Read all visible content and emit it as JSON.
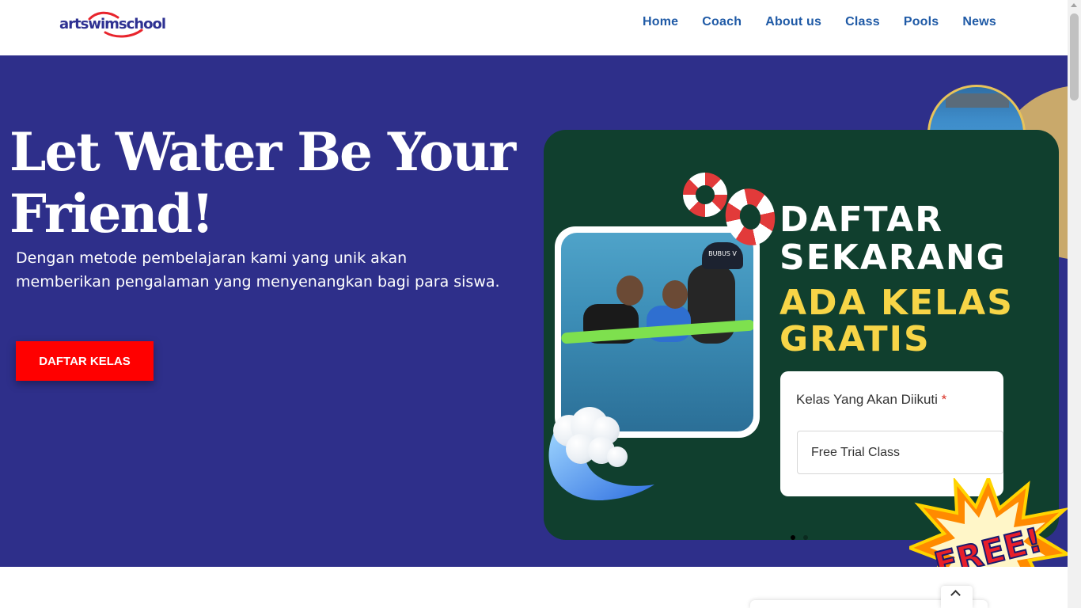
{
  "header": {
    "logo_text": "artswimschool",
    "nav": [
      "Home",
      "Coach",
      "About us",
      "Class",
      "Pools",
      "News"
    ]
  },
  "hero": {
    "title": "Let Water Be Your Friend!",
    "description": "Dengan metode pembelajaran kami yang unik akan memberikan pengalaman yang menyenangkan bagi para siswa.",
    "cta_label": "DAFTAR KELAS"
  },
  "banner": {
    "title_line1": "DAFTAR",
    "title_line2": "SEKARANG",
    "subtitle_line1": "ADA KELAS",
    "subtitle_line2": "GRATIS",
    "form_label": "Kelas Yang Akan Diikuti",
    "form_required_mark": "*",
    "form_value": "Free Trial Class",
    "badge_text": "FREE!",
    "cap_text": "BUBUS V",
    "slide_count": 2,
    "active_slide": 1
  },
  "colors": {
    "hero_bg": "#2e2f8a",
    "banner_bg": "#103f2e",
    "cta": "#ff0000",
    "nav_text": "#1f5aa6",
    "highlight": "#f7d547"
  },
  "icons": [
    "wave-icon",
    "life-ring-icon",
    "back-to-top-icon"
  ]
}
